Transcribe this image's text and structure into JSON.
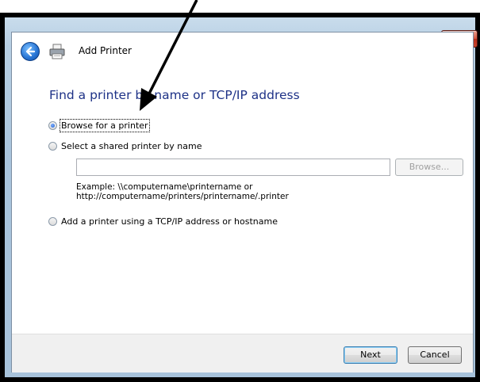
{
  "window": {
    "title": "Add Printer",
    "close_glyph": "x"
  },
  "page": {
    "heading": "Find a printer by name or TCP/IP address"
  },
  "options": [
    {
      "label": "Browse for a printer",
      "selected": true
    },
    {
      "label": "Select a shared printer by name",
      "selected": false
    },
    {
      "label": "Add a printer using a TCP/IP address or hostname",
      "selected": false
    }
  ],
  "shared_printer": {
    "value": "",
    "browse_label": "Browse...",
    "example_line1": "Example: \\\\computername\\printername or",
    "example_line2": "http://computername/printers/printername/.printer"
  },
  "footer": {
    "next_label": "Next",
    "cancel_label": "Cancel"
  },
  "icons": {
    "back": "back-arrow-icon",
    "printer": "printer-icon",
    "annotation": "annotation-arrow"
  },
  "colors": {
    "heading": "#1e3287",
    "close_button": "#c9452e",
    "chrome": "#b7cfe3"
  }
}
